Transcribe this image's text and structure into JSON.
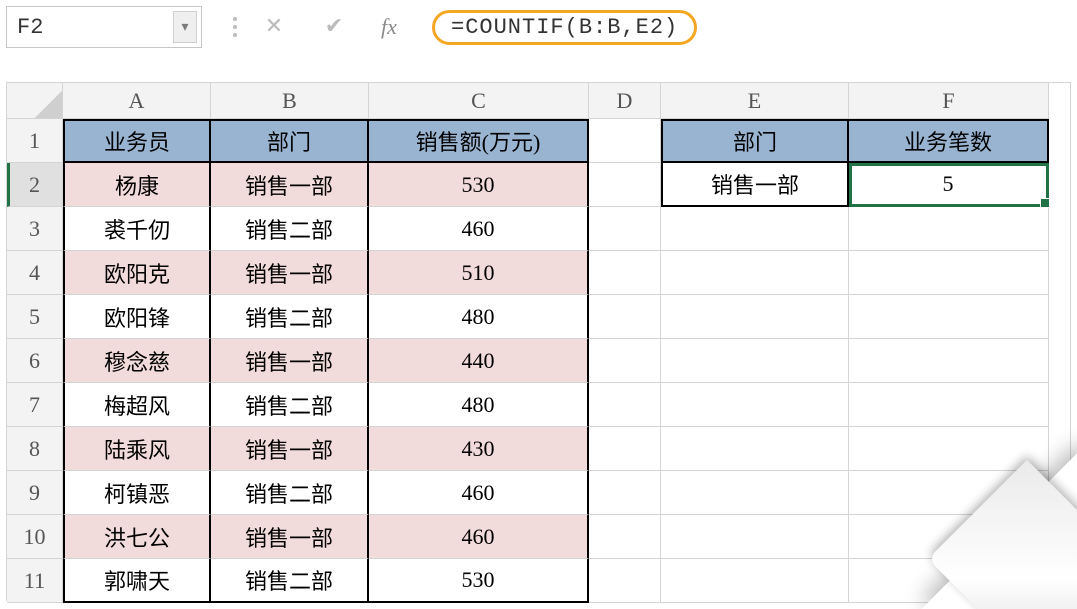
{
  "nameBox": "F2",
  "formula": "=COUNTIF(B:B,E2)",
  "fxLabel": "fx",
  "columnHeaders": [
    "A",
    "B",
    "C",
    "D",
    "E",
    "F"
  ],
  "rowNumbers": [
    "1",
    "2",
    "3",
    "4",
    "5",
    "6",
    "7",
    "8",
    "9",
    "10",
    "11"
  ],
  "activeCellRef": "F2",
  "mainTable": {
    "headers": {
      "A": "业务员",
      "B": "部门",
      "C": "销售额(万元)"
    },
    "rows": [
      {
        "A": "杨康",
        "B": "销售一部",
        "C": "530",
        "highlight": true
      },
      {
        "A": "裘千仞",
        "B": "销售二部",
        "C": "460",
        "highlight": false
      },
      {
        "A": "欧阳克",
        "B": "销售一部",
        "C": "510",
        "highlight": true
      },
      {
        "A": "欧阳锋",
        "B": "销售二部",
        "C": "480",
        "highlight": false
      },
      {
        "A": "穆念慈",
        "B": "销售一部",
        "C": "440",
        "highlight": true
      },
      {
        "A": "梅超风",
        "B": "销售二部",
        "C": "480",
        "highlight": false
      },
      {
        "A": "陆乘风",
        "B": "销售一部",
        "C": "430",
        "highlight": true
      },
      {
        "A": "柯镇恶",
        "B": "销售二部",
        "C": "460",
        "highlight": false
      },
      {
        "A": "洪七公",
        "B": "销售一部",
        "C": "460",
        "highlight": true
      },
      {
        "A": "郭啸天",
        "B": "销售二部",
        "C": "530",
        "highlight": false
      }
    ]
  },
  "sideTable": {
    "headers": {
      "E": "部门",
      "F": "业务笔数"
    },
    "row": {
      "E": "销售一部",
      "F": "5"
    }
  }
}
